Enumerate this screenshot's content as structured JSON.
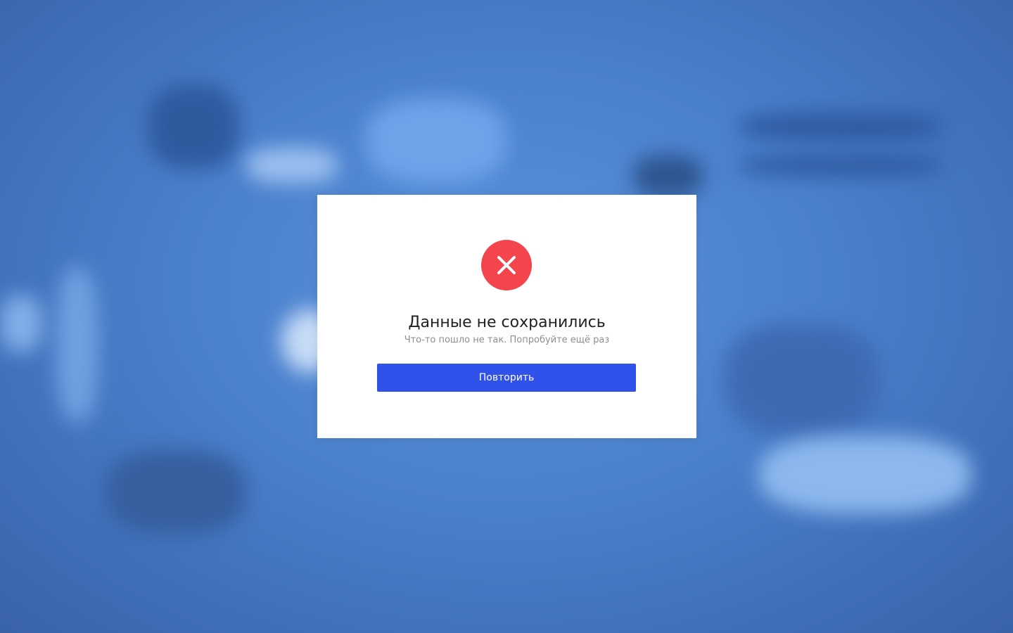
{
  "dialog": {
    "icon": "error-x-icon",
    "title": "Данные не сохранились",
    "subtitle": "Что-то пошло не так. Попробуйте ещё раз",
    "retry_label": "Повторить"
  },
  "colors": {
    "error": "#f4454d",
    "primary_button": "#3052ea",
    "backdrop": "#4b80cc"
  }
}
